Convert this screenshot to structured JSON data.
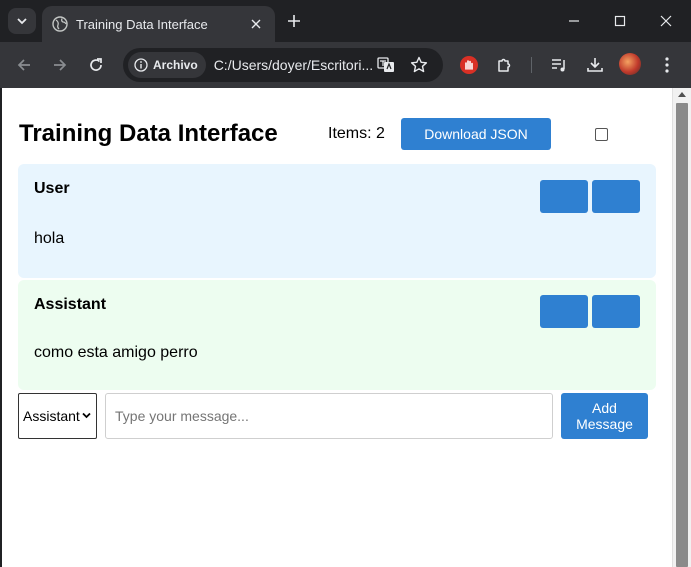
{
  "browser": {
    "tab_title": "Training Data Interface",
    "site_chip": "Archivo",
    "url": "C:/Users/doyer/Escritori..."
  },
  "app": {
    "title": "Training Data Interface",
    "items_count": "Items: 2",
    "download_label": "Download JSON"
  },
  "messages": [
    {
      "role": "User",
      "text": "hola"
    },
    {
      "role": "Assistant",
      "text": "como esta amigo perro"
    }
  ],
  "composer": {
    "selected_role": "Assistant",
    "placeholder": "Type your message...",
    "add_label": "Add Message"
  },
  "colors": {
    "accent": "#2f80d1",
    "user_bg": "#e8f5fe",
    "assistant_bg": "#edfdf0"
  }
}
